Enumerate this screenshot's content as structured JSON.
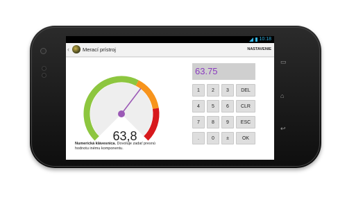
{
  "status": {
    "time": "10:18"
  },
  "actionbar": {
    "title": "Merací prístroj",
    "settings_label": "NASTAVENIE"
  },
  "gauge": {
    "value_text": "63,8",
    "value": 63.8,
    "min": 0,
    "max": 100,
    "colors": {
      "green": "#8dc63f",
      "orange": "#f7941d",
      "red": "#d7191c",
      "needle": "#9b59b6",
      "face": "#eeeeee"
    }
  },
  "description": {
    "bold": "Numerická klávesnica.",
    "rest": " Dovoluje zadať presnú hodnotu inému komponentu."
  },
  "keypad": {
    "display": "63.75",
    "rows": [
      [
        "1",
        "2",
        "3",
        "DEL"
      ],
      [
        "4",
        "5",
        "6",
        "CLR"
      ],
      [
        "7",
        "8",
        "9",
        "ESC"
      ],
      [
        ".",
        "0",
        "±",
        "OK"
      ]
    ]
  },
  "colors": {
    "display_text": "#8a3bbf",
    "status_accent": "#33b5e5"
  }
}
